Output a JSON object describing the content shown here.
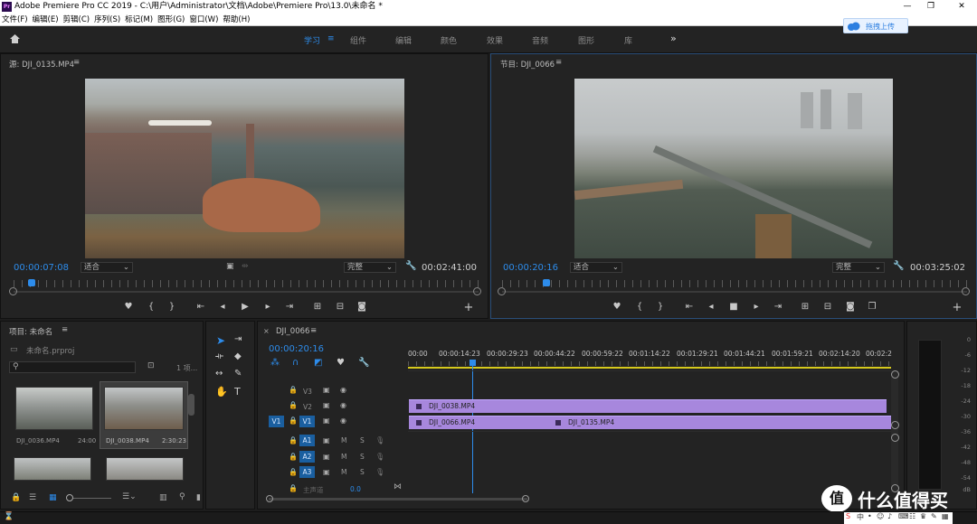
{
  "window": {
    "title": "Adobe Premiere Pro CC 2019 - C:\\用户\\Administrator\\文档\\Adobe\\Premiere Pro\\13.0\\未命名 *",
    "app_icon": "Pr",
    "minimize": "—",
    "restore": "❐",
    "close": "✕"
  },
  "menu": [
    "文件(F)",
    "编辑(E)",
    "剪辑(C)",
    "序列(S)",
    "标记(M)",
    "图形(G)",
    "窗口(W)",
    "帮助(H)"
  ],
  "workspaces": {
    "items": [
      "学习",
      "组件",
      "编辑",
      "颜色",
      "效果",
      "音频",
      "图形",
      "库"
    ],
    "active": "学习",
    "more": "»"
  },
  "upload_button": "拖拽上传",
  "source_monitor": {
    "title": "源: DJI_0135.MP4",
    "timecode": "00:00:07:08",
    "fit": "适合",
    "quality": "完整",
    "duration": "00:02:41:00"
  },
  "program_monitor": {
    "title": "节目: DJI_0066",
    "timecode": "00:00:20:16",
    "fit": "适合",
    "quality": "完整",
    "duration": "00:03:25:02"
  },
  "project": {
    "title": "项目: 未命名",
    "file": "未命名.prproj",
    "count": "1 项...",
    "items": [
      {
        "name": "DJI_0036.MP4",
        "duration": "24:00"
      },
      {
        "name": "DJI_0038.MP4",
        "duration": "2:30:23"
      }
    ]
  },
  "timeline": {
    "tab": "DJI_0066",
    "timecode": "00:00:20:16",
    "ruler": [
      "00:00",
      "00:00:14:23",
      "00:00:29:23",
      "00:00:44:22",
      "00:00:59:22",
      "00:01:14:22",
      "00:01:29:21",
      "00:01:44:21",
      "00:01:59:21",
      "00:02:14:20",
      "00:02:2"
    ],
    "video_tracks": [
      "V3",
      "V2",
      "V1"
    ],
    "audio_tracks": [
      "A1",
      "A2",
      "A3"
    ],
    "source_patch_v": "V1",
    "master": "主声道",
    "master_value": "0.0",
    "mute": "M",
    "solo": "S",
    "clips": {
      "v2": "DJI_0038.MP4",
      "v1a": "DJI_0066.MP4",
      "v1b": "DJI_0135.MP4"
    }
  },
  "meters": [
    "0",
    "-6",
    "-12",
    "-18",
    "-24",
    "-30",
    "-36",
    "-42",
    "-48",
    "-54",
    "dB"
  ],
  "watermark": {
    "text": "什么值得买",
    "badge": "值"
  },
  "taskbar_icons": [
    "S",
    "中",
    "•",
    "☺",
    "♪",
    "⌨",
    "☷",
    "♛",
    "✎",
    "▦"
  ]
}
